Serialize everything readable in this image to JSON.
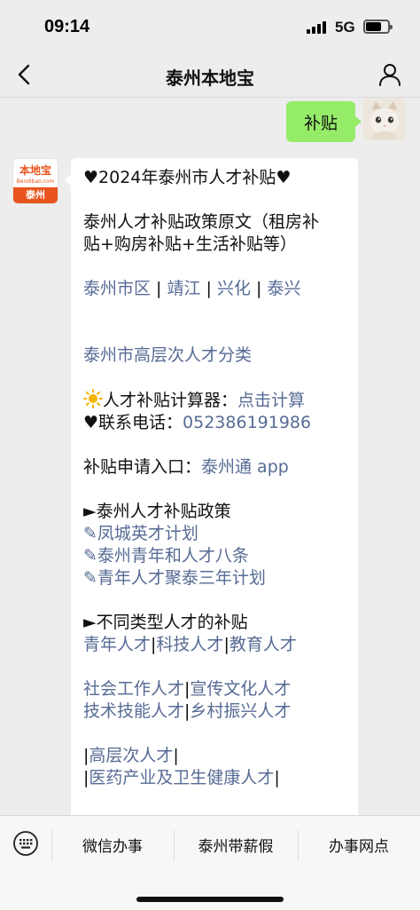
{
  "status_bar": {
    "time": "09:14",
    "network": "5G",
    "battery_level": 0.65
  },
  "nav": {
    "title": "泰州本地宝",
    "back_icon": "chevron-left-icon",
    "profile_icon": "person-icon"
  },
  "chat": {
    "user_message": "补贴",
    "bot_avatar": {
      "logo_text": "本地宝",
      "logo_sub": "Bendibao.com",
      "city": "泰州"
    },
    "message": {
      "heading": "♥2024年泰州市人才补贴♥",
      "policy_line1": "泰州人才补贴政策原文（租房补",
      "policy_line2": "贴+购房补贴+生活补贴等）",
      "districts": [
        "泰州市区",
        "靖江",
        "兴化",
        "泰兴"
      ],
      "district_sep": " | ",
      "talent_class": "泰州市高层次人才分类",
      "calc_label": "人才补贴计算器：",
      "calc_link": "点击计算",
      "contact_label": "♥联系电话：",
      "contact_phone": "052386191986",
      "apply_label": "补贴申请入口：",
      "apply_link": "泰州通 app",
      "policy_heading": "►泰州人才补贴政策",
      "policy_links": [
        "✎凤城英才计划",
        "✎泰州青年和人才八条",
        "✎青年人才聚泰三年计划"
      ],
      "types_heading": "►不同类型人才的补贴",
      "types_row1": [
        "青年人才",
        "科技人才",
        "教育人才"
      ],
      "types_row2": [
        "社会工作人才",
        "宣传文化人才"
      ],
      "types_row3": [
        "技术技能人才",
        "乡村振兴人才"
      ],
      "types_row4": [
        "高层次人才"
      ],
      "types_row5": [
        "医药产业及卫生健康人才"
      ]
    }
  },
  "bottom_menu": {
    "items": [
      "微信办事",
      "泰州带薪假",
      "办事网点"
    ]
  },
  "colors": {
    "link": "#576b95",
    "my_bubble": "#95ec69",
    "brand": "#e8541e"
  }
}
